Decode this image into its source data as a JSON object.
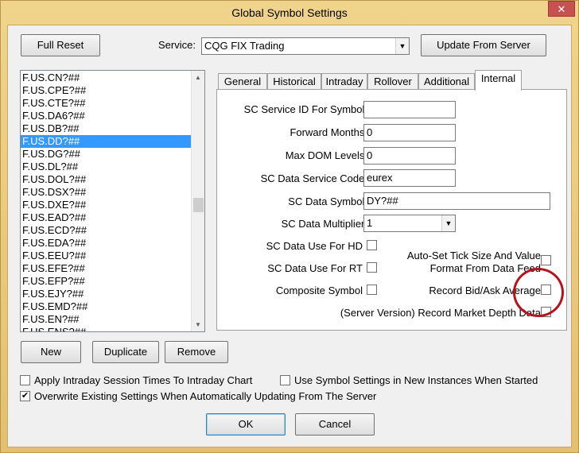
{
  "window": {
    "title": "Global Symbol Settings",
    "close_label": "✕"
  },
  "toolbar": {
    "full_reset": "Full Reset",
    "service_label": "Service:",
    "service_value": "CQG FIX Trading",
    "update_from_server": "Update From Server"
  },
  "symbol_list": {
    "items": [
      "F.US.CN?##",
      "F.US.CPE?##",
      "F.US.CTE?##",
      "F.US.DA6?##",
      "F.US.DB?##",
      "F.US.DD?##",
      "F.US.DG?##",
      "F.US.DL?##",
      "F.US.DOL?##",
      "F.US.DSX?##",
      "F.US.DXE?##",
      "F.US.EAD?##",
      "F.US.ECD?##",
      "F.US.EDA?##",
      "F.US.EEU?##",
      "F.US.EFE?##",
      "F.US.EFP?##",
      "F.US.EJY?##",
      "F.US.EMD?##",
      "F.US.EN?##",
      "F.US.ENS?##"
    ],
    "selected": "F.US.DD?##"
  },
  "tabs": [
    "General",
    "Historical",
    "Intraday",
    "Rollover",
    "Additional",
    "Internal"
  ],
  "active_tab": "Internal",
  "internal": {
    "sc_service_id_label": "SC Service ID For Symbol:",
    "sc_service_id_value": "",
    "forward_months_label": "Forward Months:",
    "forward_months_value": "0",
    "max_dom_label": "Max DOM Levels:",
    "max_dom_value": "0",
    "data_service_code_label": "SC Data Service Code:",
    "data_service_code_value": "eurex",
    "data_symbol_label": "SC Data Symbol:",
    "data_symbol_value": "DY?##",
    "data_multiplier_label": "SC Data Multiplier:",
    "data_multiplier_value": "1",
    "use_for_hd_label": "SC Data Use For HD",
    "use_for_rt_label": "SC Data Use For RT",
    "composite_label": "Composite Symbol",
    "auto_tick_label_1": "Auto-Set Tick Size And Value",
    "auto_tick_label_2": "Format From Data Feed",
    "record_bid_ask_label": "Record Bid/Ask Average",
    "record_depth_label": "(Server Version) Record Market Depth Data"
  },
  "list_buttons": {
    "new": "New",
    "duplicate": "Duplicate",
    "remove": "Remove"
  },
  "options": {
    "apply_intraday": "Apply Intraday Session Times To Intraday Chart",
    "use_symbol_settings": "Use Symbol Settings in New Instances When Started",
    "overwrite": "Overwrite Existing Settings When Automatically Updating From The Server"
  },
  "footer": {
    "ok": "OK",
    "cancel": "Cancel"
  },
  "glyphs": {
    "check": "✔",
    "down_arrow": "▼",
    "up_arrow": "▲"
  },
  "colors": {
    "frame": "#e9c874",
    "selection": "#3399ff",
    "highlight_circle": "#b5141d"
  }
}
